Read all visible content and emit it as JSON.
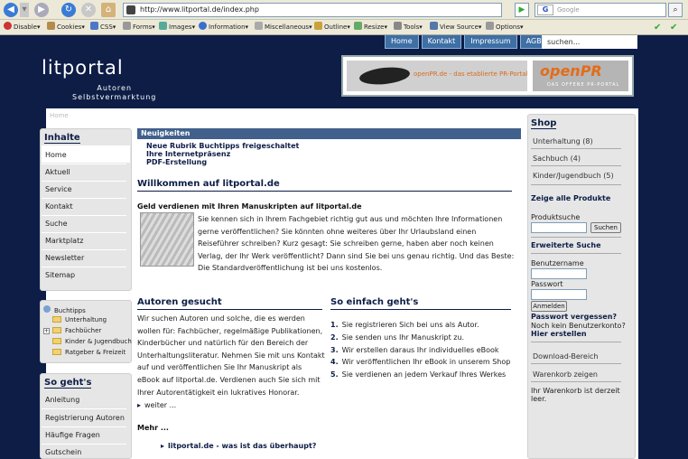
{
  "browser": {
    "url": "http://www.litportal.de/index.php",
    "search_placeholder": "Google",
    "search_engine_label": "G"
  },
  "toolbar": {
    "items": [
      "Disable",
      "Cookies",
      "CSS",
      "Forms",
      "Images",
      "Information",
      "Miscellaneous",
      "Outline",
      "Resize",
      "Tools",
      "View Source",
      "Options"
    ]
  },
  "topnav": {
    "items": [
      "Home",
      "Kontakt",
      "Impressum",
      "AGB"
    ],
    "search_text": "suchen..."
  },
  "header": {
    "logo": "litportal",
    "subtitle_1": "Autoren",
    "subtitle_2": "Selbstvermarktung"
  },
  "banner": {
    "text": "openPR.de - das etablierte PR-Portal",
    "logo": "openPR",
    "logo_sub": "DAS OFFENE PR-PORTAL"
  },
  "breadcrumb": "Home",
  "left_nav": {
    "title": "Inhalte",
    "items": [
      "Home",
      "Aktuell",
      "Service",
      "Kontakt",
      "Suche",
      "Marktplatz",
      "Newsletter",
      "Sitemap"
    ]
  },
  "tree": {
    "root": "Buchtipps",
    "items": [
      "Unterhaltung",
      "Fachbücher",
      "Kinder & Jugendbuch",
      "Ratgeber & Freizeit"
    ]
  },
  "sogehts_box": {
    "title": "So geht's",
    "items": [
      "Anleitung",
      "Registrierung Autoren",
      "Häufige Fragen",
      "Gutschein"
    ]
  },
  "news": {
    "title": "Neuigkeiten",
    "items": [
      "Neue Rubrik Buchtipps freigeschaltet",
      "Ihre Internetpräsenz",
      "PDF-Erstellung"
    ]
  },
  "welcome": {
    "title": "Willkommen auf litportal.de",
    "subtitle": "Geld verdienen mit Ihren Manuskripten auf litportal.de",
    "lines": [
      "Sie kennen sich in Ihrem Fachgebiet richtig gut aus und möchten Ihre Informationen",
      "gerne veröffentlichen? Sie könnten ohne weiteres über Ihr Urlaubsland einen",
      "Reiseführer schreiben?  Kurz gesagt: Sie schreiben gerne, haben aber noch keinen",
      "Verlag, der Ihr Werk veröffentlicht? Dann sind Sie bei uns genau richtig. Und das Beste:",
      "Die Standardveröffentlichung ist bei uns kostenlos."
    ]
  },
  "authors": {
    "title": "Autoren gesucht",
    "lines": [
      "Wir suchen Autoren und solche, die es werden",
      "wollen für: Fachbücher, regelmäßige Publikationen,",
      "Kinderbücher und natürlich für den Bereich der",
      "Unterhaltungsliteratur. Nehmen Sie mit uns Kontakt",
      "auf und veröffentlichen Sie Ihr Manuskript als",
      "eBook auf litportal.de. Verdienen auch Sie sich mit",
      "Ihrer Autorentätigkeit ein lukratives Honorar."
    ],
    "more": "weiter ..."
  },
  "easy": {
    "title": "So einfach geht's",
    "steps": [
      {
        "n": "1.",
        "text": "Sie registrieren Sich bei uns als Autor."
      },
      {
        "n": "2.",
        "text": "Sie senden uns Ihr Manuskript zu."
      },
      {
        "n": "3.",
        "text": "Wir erstellen daraus Ihr individuelles eBook"
      },
      {
        "n": "4.",
        "text": "Wir veröffentlichen Ihr eBook in unserem Shop"
      },
      {
        "n": "5.",
        "text": "Sie verdienen an jedem Verkauf Ihres Werkes"
      }
    ]
  },
  "mehr": {
    "title": "Mehr ...",
    "link": "litportal.de - was ist das überhaupt?"
  },
  "shop": {
    "title": "Shop",
    "categories": [
      "Unterhaltung (8)",
      "Sachbuch (4)",
      "Kinder/Jugendbuch (5)"
    ],
    "all_products": "Zeige alle Produkte",
    "search_label": "Produktsuche",
    "search_button": "Suchen",
    "advanced_search": "Erweiterte Suche",
    "user_label": "Benutzername",
    "password_label": "Passwort",
    "login_button": "Anmelden",
    "forgot": "Passwort vergessen?",
    "no_account": "Noch kein Benutzerkonto?",
    "register": "Hier erstellen",
    "download": "Download-Bereich",
    "cart": "Warenkorb zeigen",
    "cart_status_1": "Ihr Warenkorb ist derzeit",
    "cart_status_2": "leer."
  }
}
